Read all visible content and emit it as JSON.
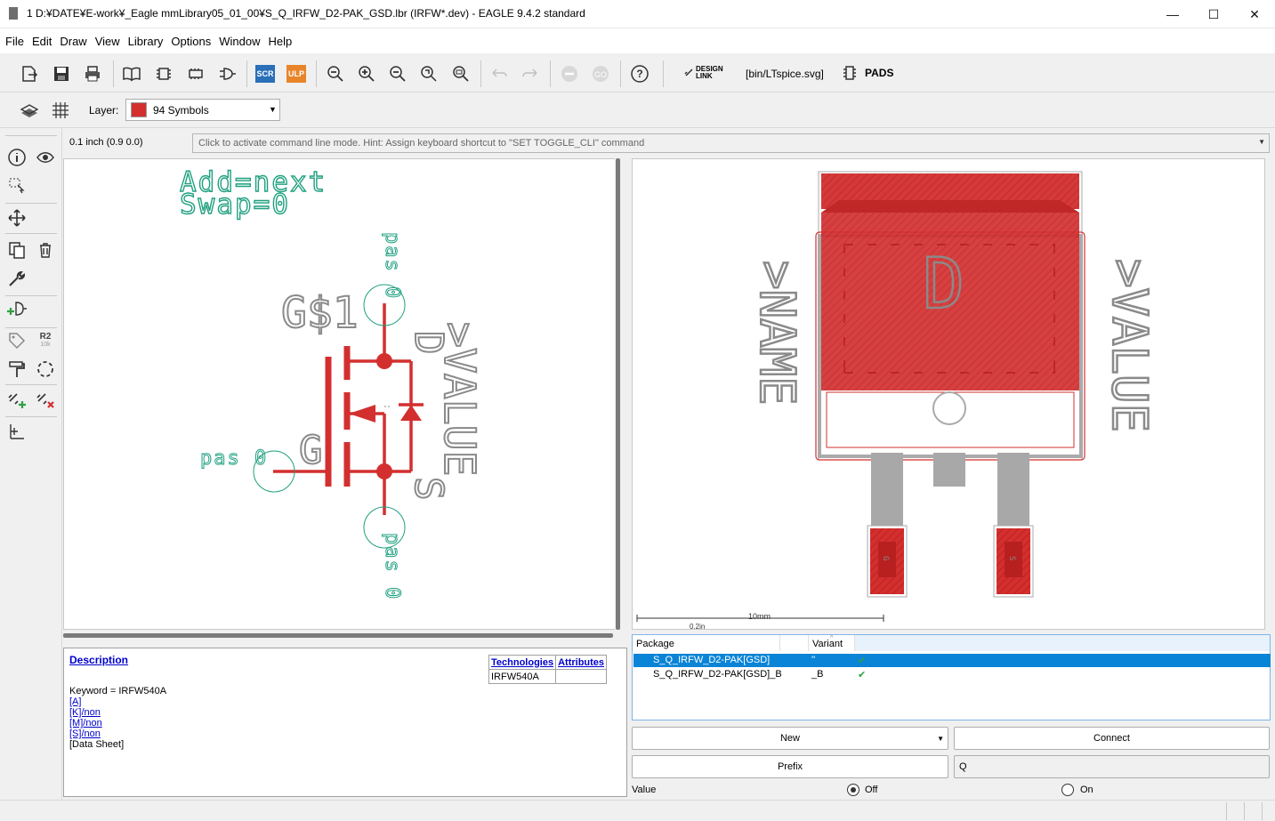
{
  "window": {
    "title": "1 D:¥DATE¥E-work¥_Eagle mmLibrary05_01_00¥S_Q_IRFW_D2-PAK_GSD.lbr (IRFW*.dev) - EAGLE 9.4.2 standard",
    "minimize": "—",
    "maximize": "☐",
    "close": "✕"
  },
  "menu": [
    "File",
    "Edit",
    "Draw",
    "View",
    "Library",
    "Options",
    "Window",
    "Help"
  ],
  "toolbar": {
    "scr_label": "SCR",
    "ulp_label": "ULP",
    "design_link_line1": "DESIGN",
    "design_link_line2": "LINK",
    "script_label": "[bin/LTspice.svg]",
    "pads_label": "PADS"
  },
  "layerbar": {
    "layer_label": "Layer:",
    "layer_value": "94 Symbols",
    "layer_color": "#d32f2f"
  },
  "coordinate": "0.1 inch (0.9 0.0)",
  "command_hint": "Click to activate command line mode. Hint: Assign keyboard shortcut to \"SET TOGGLE_CLI\" command",
  "leftbar": {
    "r2_label": "R2",
    "r2_sub": "10k"
  },
  "symbol": {
    "add_text": "Add=next",
    "swap_text": "Swap=0",
    "name_text": "G$1",
    "value_text": ">VALUE",
    "pin_d_name": "pas 0",
    "pin_g_name": "pas 0",
    "pin_s_name": "pas 0",
    "label_d": "D",
    "label_g": "G",
    "label_s": "S"
  },
  "package": {
    "name_text": ">NAME",
    "value_text": ">VALUE",
    "tab_label": "D",
    "pad_g": "G",
    "pad_s": "S",
    "scale_label": "10mm",
    "scale_sub": "0.2in"
  },
  "description": {
    "title": "Description",
    "keyword": "Keyword = IRFW540A",
    "links": [
      "[A]",
      "[K]/non",
      "[M]/non",
      "[S]/non"
    ],
    "datasheet": "[Data Sheet]",
    "tech_header": "Technologies",
    "attr_header": "Attributes",
    "tech_value": "IRFW540A"
  },
  "packages": {
    "col_package": "Package",
    "col_variant": "Variant",
    "rows": [
      {
        "package": "S_Q_IRFW_D2-PAK[GSD]",
        "variant": "''",
        "selected": true
      },
      {
        "package": "S_Q_IRFW_D2-PAK[GSD]_B",
        "variant": "_B",
        "selected": false
      }
    ]
  },
  "buttons": {
    "new": "New",
    "connect": "Connect",
    "prefix": "Prefix",
    "prefix_value": "Q"
  },
  "value_option": {
    "label": "Value",
    "off": "Off",
    "on": "On",
    "selected": "off"
  },
  "colors": {
    "symbol_red": "#d32f2f",
    "pin_green": "#20a080",
    "text_gray": "#8a8a8a",
    "pad_red": "#d32f2f",
    "selection_blue": "#0a84d6"
  }
}
